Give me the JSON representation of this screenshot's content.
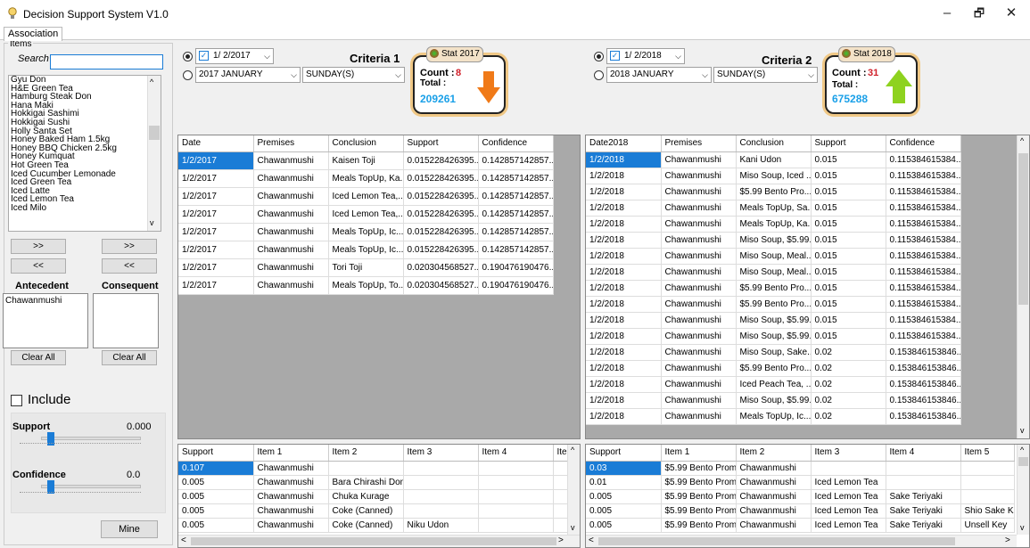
{
  "window": {
    "title": "Decision Support System V1.0",
    "minimize": "–",
    "maximize": "🗗",
    "close": "✕"
  },
  "tab": "Association",
  "left": {
    "items_label": "Items",
    "search_label": "Search",
    "search_value": "",
    "items": [
      "Gyu Don",
      "H&E Green Tea",
      "Hamburg Steak Don",
      "Hana Maki",
      "Hokkigai Sashimi",
      "Hokkigai Sushi",
      "Holly Santa Set",
      "Honey Baked Ham 1.5kg",
      "Honey BBQ Chicken 2.5kg",
      "Honey Kumquat",
      "Hot Green Tea",
      "Iced Cucumber Lemonade",
      "Iced Green Tea",
      "Iced Latte",
      "Iced Lemon Tea",
      "Iced Milo"
    ],
    "add_ante": ">>",
    "add_cons": ">>",
    "rem_ante": "<<",
    "rem_cons": "<<",
    "antecedent_label": "Antecedent",
    "consequent_label": "Consequent",
    "antecedent_items": [
      "Chawanmushi"
    ],
    "consequent_items": [],
    "clear_ante": "Clear All",
    "clear_cons": "Clear All",
    "include_label": "Include",
    "support_label": "Support",
    "support_value": "0.000",
    "confidence_label": "Confidence",
    "confidence_value": "0.0",
    "support_level": 0.05,
    "confidence_level": 0.05,
    "mine": "Mine"
  },
  "crit1": {
    "date": "1/ 2/2017",
    "month": "2017 JANUARY",
    "day": "SUNDAY(S)",
    "title": "Criteria 1",
    "stat_btn": "Stat 2017",
    "count_label": "Count :",
    "count": "8",
    "total_label": "Total :",
    "total": "209261",
    "trend": "down"
  },
  "crit2": {
    "date": "1/ 2/2018",
    "month": "2018 JANUARY",
    "day": "SUNDAY(S)",
    "title": "Criteria 2",
    "stat_btn": "Stat 2018",
    "count_label": "Count :",
    "count": "31",
    "total_label": "Total :",
    "total": "675288",
    "trend": "up"
  },
  "grid1": {
    "headers": [
      "Date",
      "Premises",
      "Conclusion",
      "Support",
      "Confidence"
    ],
    "rows": [
      [
        "1/2/2017",
        "Chawanmushi",
        "Kaisen Toji",
        "0.015228426395...",
        "0.142857142857..."
      ],
      [
        "1/2/2017",
        "Chawanmushi",
        "Meals TopUp, Ka...",
        "0.015228426395...",
        "0.142857142857..."
      ],
      [
        "1/2/2017",
        "Chawanmushi",
        "Iced Lemon Tea,...",
        "0.015228426395...",
        "0.142857142857..."
      ],
      [
        "1/2/2017",
        "Chawanmushi",
        "Iced Lemon Tea,...",
        "0.015228426395...",
        "0.142857142857..."
      ],
      [
        "1/2/2017",
        "Chawanmushi",
        "Meals TopUp, Ic...",
        "0.015228426395...",
        "0.142857142857..."
      ],
      [
        "1/2/2017",
        "Chawanmushi",
        "Meals TopUp, Ic...",
        "0.015228426395...",
        "0.142857142857..."
      ],
      [
        "1/2/2017",
        "Chawanmushi",
        "Tori Toji",
        "0.020304568527...",
        "0.190476190476..."
      ],
      [
        "1/2/2017",
        "Chawanmushi",
        "Meals TopUp, To...",
        "0.020304568527...",
        "0.190476190476..."
      ]
    ]
  },
  "grid2": {
    "headers": [
      "Date2018",
      "Premises",
      "Conclusion",
      "Support",
      "Confidence"
    ],
    "rows": [
      [
        "1/2/2018",
        "Chawanmushi",
        "Kani Udon",
        "0.015",
        "0.115384615384..."
      ],
      [
        "1/2/2018",
        "Chawanmushi",
        "Miso Soup, Iced ...",
        "0.015",
        "0.115384615384..."
      ],
      [
        "1/2/2018",
        "Chawanmushi",
        "$5.99 Bento Pro...",
        "0.015",
        "0.115384615384..."
      ],
      [
        "1/2/2018",
        "Chawanmushi",
        "Meals TopUp, Sa...",
        "0.015",
        "0.115384615384..."
      ],
      [
        "1/2/2018",
        "Chawanmushi",
        "Meals TopUp, Ka...",
        "0.015",
        "0.115384615384..."
      ],
      [
        "1/2/2018",
        "Chawanmushi",
        "Miso Soup, $5.99...",
        "0.015",
        "0.115384615384..."
      ],
      [
        "1/2/2018",
        "Chawanmushi",
        "Miso Soup, Meal...",
        "0.015",
        "0.115384615384..."
      ],
      [
        "1/2/2018",
        "Chawanmushi",
        "Miso Soup, Meal...",
        "0.015",
        "0.115384615384..."
      ],
      [
        "1/2/2018",
        "Chawanmushi",
        "$5.99 Bento Pro...",
        "0.015",
        "0.115384615384..."
      ],
      [
        "1/2/2018",
        "Chawanmushi",
        "$5.99 Bento Pro...",
        "0.015",
        "0.115384615384..."
      ],
      [
        "1/2/2018",
        "Chawanmushi",
        "Miso Soup, $5.99...",
        "0.015",
        "0.115384615384..."
      ],
      [
        "1/2/2018",
        "Chawanmushi",
        "Miso Soup, $5.99...",
        "0.015",
        "0.115384615384..."
      ],
      [
        "1/2/2018",
        "Chawanmushi",
        "Miso Soup, Sake...",
        "0.02",
        "0.153846153846..."
      ],
      [
        "1/2/2018",
        "Chawanmushi",
        "$5.99 Bento Pro...",
        "0.02",
        "0.153846153846..."
      ],
      [
        "1/2/2018",
        "Chawanmushi",
        "Iced Peach Tea, ...",
        "0.02",
        "0.153846153846..."
      ],
      [
        "1/2/2018",
        "Chawanmushi",
        "Miso Soup, $5.99...",
        "0.02",
        "0.153846153846..."
      ],
      [
        "1/2/2018",
        "Chawanmushi",
        "Meals TopUp, Ic...",
        "0.02",
        "0.153846153846..."
      ]
    ]
  },
  "grid3": {
    "headers": [
      "Support",
      "Item 1",
      "Item 2",
      "Item 3",
      "Item 4",
      "Iter"
    ],
    "rows": [
      [
        "0.107",
        "Chawanmushi",
        "",
        "",
        "",
        ""
      ],
      [
        "0.005",
        "Chawanmushi",
        "Bara Chirashi Don",
        "",
        "",
        ""
      ],
      [
        "0.005",
        "Chawanmushi",
        "Chuka Kurage",
        "",
        "",
        ""
      ],
      [
        "0.005",
        "Chawanmushi",
        "Coke (Canned)",
        "",
        "",
        ""
      ],
      [
        "0.005",
        "Chawanmushi",
        "Coke (Canned)",
        "Niku Udon",
        "",
        ""
      ]
    ]
  },
  "grid4": {
    "headers": [
      "Support",
      "Item 1",
      "Item 2",
      "Item 3",
      "Item 4",
      "Item 5"
    ],
    "rows": [
      [
        "0.03",
        "$5.99 Bento Promo",
        "Chawanmushi",
        "",
        "",
        ""
      ],
      [
        "0.01",
        "$5.99 Bento Promo",
        "Chawanmushi",
        "Iced Lemon Tea",
        "",
        ""
      ],
      [
        "0.005",
        "$5.99 Bento Promo",
        "Chawanmushi",
        "Iced Lemon Tea",
        "Sake Teriyaki",
        ""
      ],
      [
        "0.005",
        "$5.99 Bento Promo",
        "Chawanmushi",
        "Iced Lemon Tea",
        "Sake Teriyaki",
        "Shio Sake Ka"
      ],
      [
        "0.005",
        "$5.99 Bento Promo",
        "Chawanmushi",
        "Iced Lemon Tea",
        "Sake Teriyaki",
        "Unsell Key"
      ]
    ]
  }
}
